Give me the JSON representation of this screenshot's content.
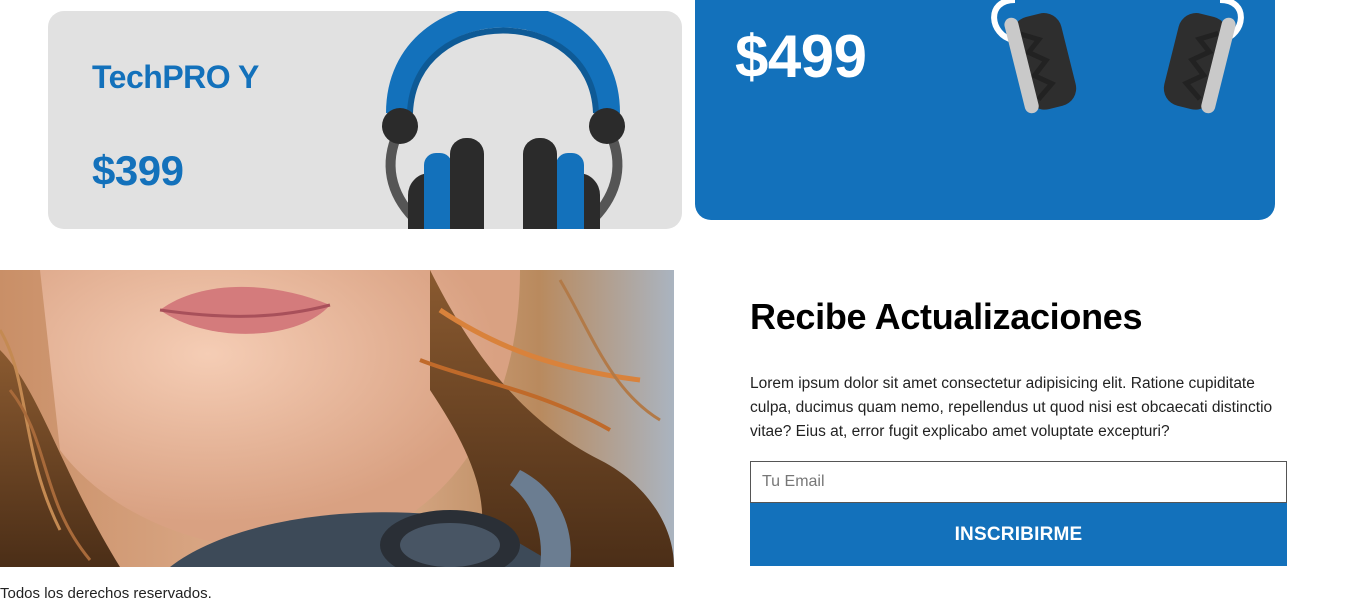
{
  "products": {
    "card_left": {
      "name": "TechPRO Y",
      "price": "$399",
      "icon": "headphones-front-icon"
    },
    "card_right": {
      "price": "$499",
      "icon": "headphones-side-icon"
    }
  },
  "newsletter": {
    "title": "Recibe Actualizaciones",
    "description": "Lorem ipsum dolor sit amet consectetur adipisicing elit. Ratione cupiditate culpa, ducimus quam nemo, repellendus ut quod nisi est obcaecati distinctio vitae? Eius at, error fugit explicabo amet voluptate excepturi?",
    "email_placeholder": "Tu Email",
    "button_label": "INSCRIBIRME"
  },
  "footer": {
    "text": "Todos los derechos reservados."
  },
  "colors": {
    "brand_blue": "#1371bb",
    "card_gray": "#e1e1e1"
  }
}
